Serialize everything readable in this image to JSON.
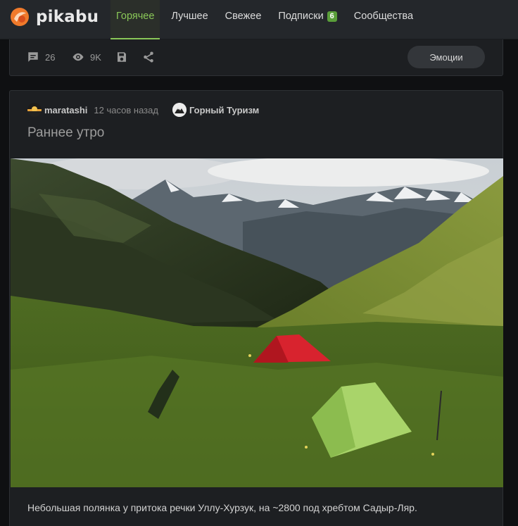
{
  "header": {
    "logo_text": "pikabu",
    "nav": [
      {
        "label": "Горячее",
        "active": true
      },
      {
        "label": "Лучшее"
      },
      {
        "label": "Свежее"
      },
      {
        "label": "Подписки",
        "badge": "6"
      },
      {
        "label": "Сообщества"
      }
    ]
  },
  "prev_story": {
    "comments": "26",
    "views": "9K",
    "emotions_label": "Эмоции"
  },
  "story": {
    "author": "maratashi",
    "time": "12 часов назад",
    "community": "Горный Туризм",
    "title": "Раннее утро",
    "caption": "Небольшая полянка у притока речки Уллу-Хурзук, на ~2800 под хребтом Садыр-Ляр."
  },
  "colors": {
    "accent": "#8ac858",
    "badge": "#5a9e3a",
    "background": "#0f1012",
    "card": "#1d1f22"
  }
}
